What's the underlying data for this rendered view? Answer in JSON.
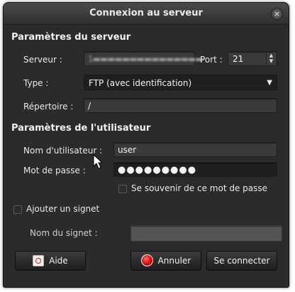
{
  "window": {
    "title": "Connexion au serveur"
  },
  "server_section": {
    "heading": "Paramètres du serveur",
    "server_label": "Serveur :",
    "server_value": "1▬▬▬▬▬▬▬▬▬▬▬▬▬▬▬",
    "port_label": "Port :",
    "port_value": "21",
    "type_label": "Type :",
    "type_value": "FTP (avec identification)",
    "directory_label": "Répertoire :",
    "directory_value": "/"
  },
  "user_section": {
    "heading": "Paramètres de l'utilisateur",
    "username_label": "Nom d'utilisateur :",
    "username_value": "user",
    "password_label": "Mot de passe :",
    "password_value": "●●●●●●●●●",
    "remember_label": "Se souvenir de ce mot de passe"
  },
  "bookmark": {
    "add_label": "Ajouter un signet",
    "name_label": "Nom du signet :",
    "name_value": ""
  },
  "buttons": {
    "help": "Aide",
    "cancel": "Annuler",
    "connect": "Se connecter"
  },
  "icons": {
    "close": "close-icon",
    "help": "help-icon",
    "cancel": "cancel-icon",
    "dropdown": "chevron-down-icon",
    "spin": "spinner-arrows-icon"
  }
}
